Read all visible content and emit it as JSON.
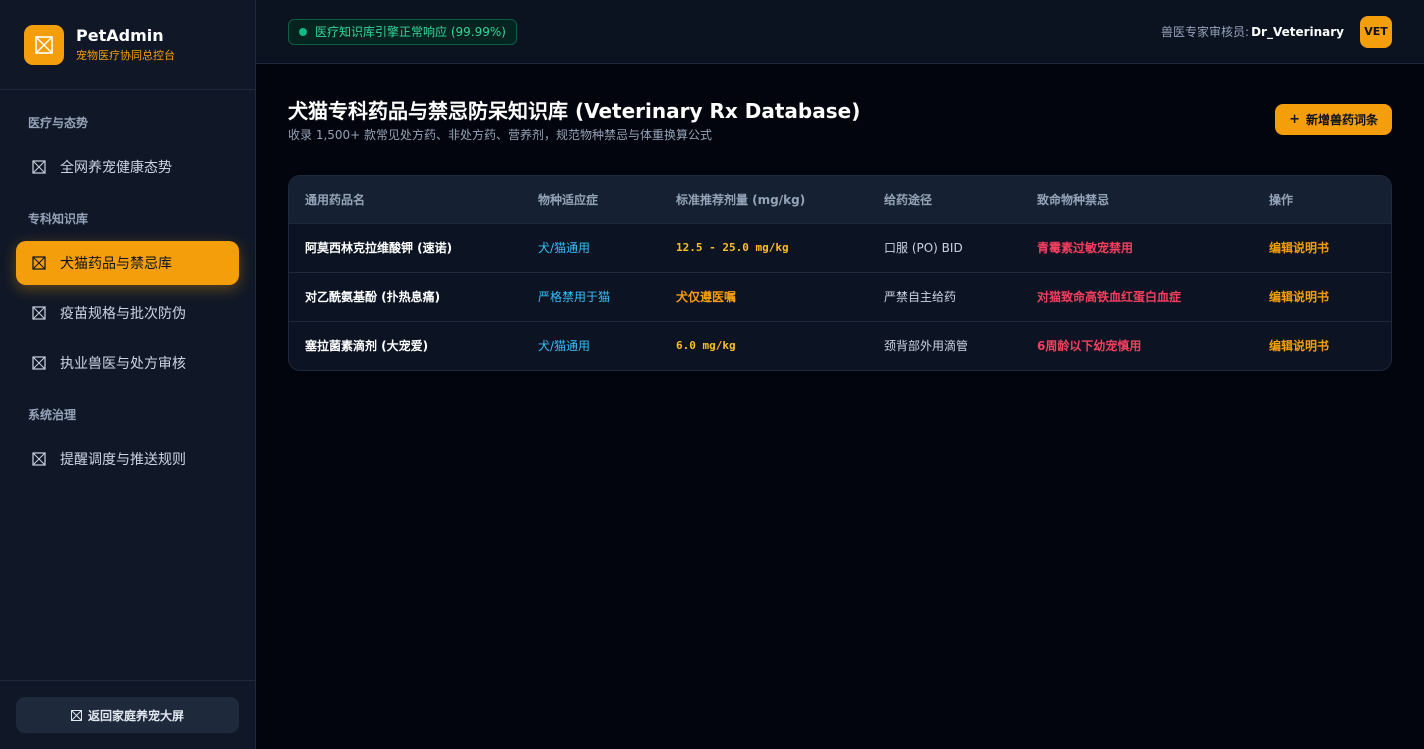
{
  "brand": {
    "title": "PetAdmin",
    "subtitle": "宠物医疗协同总控台"
  },
  "sidebar": {
    "sections": [
      {
        "label": "医疗与态势",
        "items": [
          {
            "label": "全网养宠健康态势",
            "active": false
          }
        ]
      },
      {
        "label": "专科知识库",
        "items": [
          {
            "label": "犬猫药品与禁忌库",
            "active": true
          },
          {
            "label": "疫苗规格与批次防伪",
            "active": false
          },
          {
            "label": "执业兽医与处方审核",
            "active": false
          }
        ]
      },
      {
        "label": "系统治理",
        "items": [
          {
            "label": "提醒调度与推送规则",
            "active": false
          }
        ]
      }
    ],
    "footer_button": "返回家庭养宠大屏"
  },
  "topbar": {
    "status": "医疗知识库引擎正常响应 (99.99%)",
    "reviewer_label": "兽医专家审核员:",
    "reviewer_name": "Dr_Veterinary",
    "avatar": "VET"
  },
  "page": {
    "title": "犬猫专科药品与禁忌防呆知识库 (Veterinary Rx Database)",
    "subtitle": "收录 1,500+ 款常见处方药、非处方药、营养剂，规范物种禁忌与体重换算公式",
    "add_button": "新增兽药词条"
  },
  "table": {
    "headers": [
      "通用药品名",
      "物种适应症",
      "标准推荐剂量 (mg/kg)",
      "给药途径",
      "致命物种禁忌",
      "操作"
    ],
    "rows": [
      {
        "name": "阿莫西林克拉维酸钾 (速诺)",
        "species": "犬/猫通用",
        "dose": "12.5 - 25.0 mg/kg",
        "route": "口服 (PO) BID",
        "contra": "青霉素过敏宠禁用",
        "action": "编辑说明书"
      },
      {
        "name": "对乙酰氨基酚 (扑热息痛)",
        "species": "严格禁用于猫",
        "dose": "犬仅遵医嘱",
        "route": "严禁自主给药",
        "contra": "对猫致命高铁血红蛋白血症",
        "action": "编辑说明书"
      },
      {
        "name": "塞拉菌素滴剂 (大宠爱)",
        "species": "犬/猫通用",
        "dose": "6.0 mg/kg",
        "route": "颈背部外用滴管",
        "contra": "6周龄以下幼宠慎用",
        "action": "编辑说明书"
      }
    ]
  },
  "colors": {
    "accent": "#f59e0b",
    "success": "#10b981",
    "danger": "#f43f5e",
    "info": "#38bdf8"
  },
  "icons": {
    "logo": "broken-image-icon",
    "nav": "broken-image-icon",
    "add": "plus-icon"
  }
}
